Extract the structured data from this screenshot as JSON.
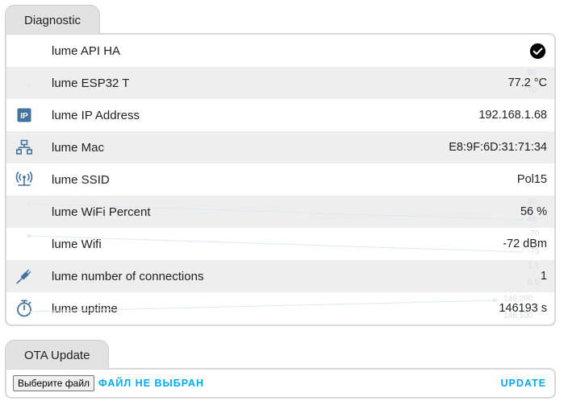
{
  "colors": {
    "icon": "#44739e",
    "accent": "#03a9f4",
    "row_alt": "#eeeeee"
  },
  "diagnostic": {
    "tab_label": "Diagnostic",
    "rows": [
      {
        "icon": "none",
        "label": "lume API HA",
        "value": "check-circle"
      },
      {
        "icon": "none",
        "label": "lume ESP32 T",
        "value": "77.2 °C"
      },
      {
        "icon": "ip-icon",
        "label": "lume IP Address",
        "value": "192.168.1.68"
      },
      {
        "icon": "network-icon",
        "label": "lume Mac",
        "value": "E8:9F:6D:31:71:34"
      },
      {
        "icon": "wifi-antenna-icon",
        "label": "lume SSID",
        "value": "Pol15"
      },
      {
        "icon": "none",
        "label": "lume WiFi Percent",
        "value": "56 %"
      },
      {
        "icon": "none",
        "label": "lume Wifi",
        "value": "-72 dBm"
      },
      {
        "icon": "plug-icon",
        "label": "lume number of connections",
        "value": "1"
      },
      {
        "icon": "timer-icon",
        "label": "lume uptime",
        "value": "146193 s"
      }
    ],
    "ghost_labels": [
      "90",
      "70",
      "60",
      "46",
      "-70",
      "-75",
      "1.1",
      "0.9",
      "146,200",
      "146,100"
    ]
  },
  "ota": {
    "tab_label": "OTA Update",
    "file_button": "Выберите файл",
    "file_status": "ФАЙЛ НЕ ВЫБРАН",
    "update_label": "UPDATE"
  }
}
